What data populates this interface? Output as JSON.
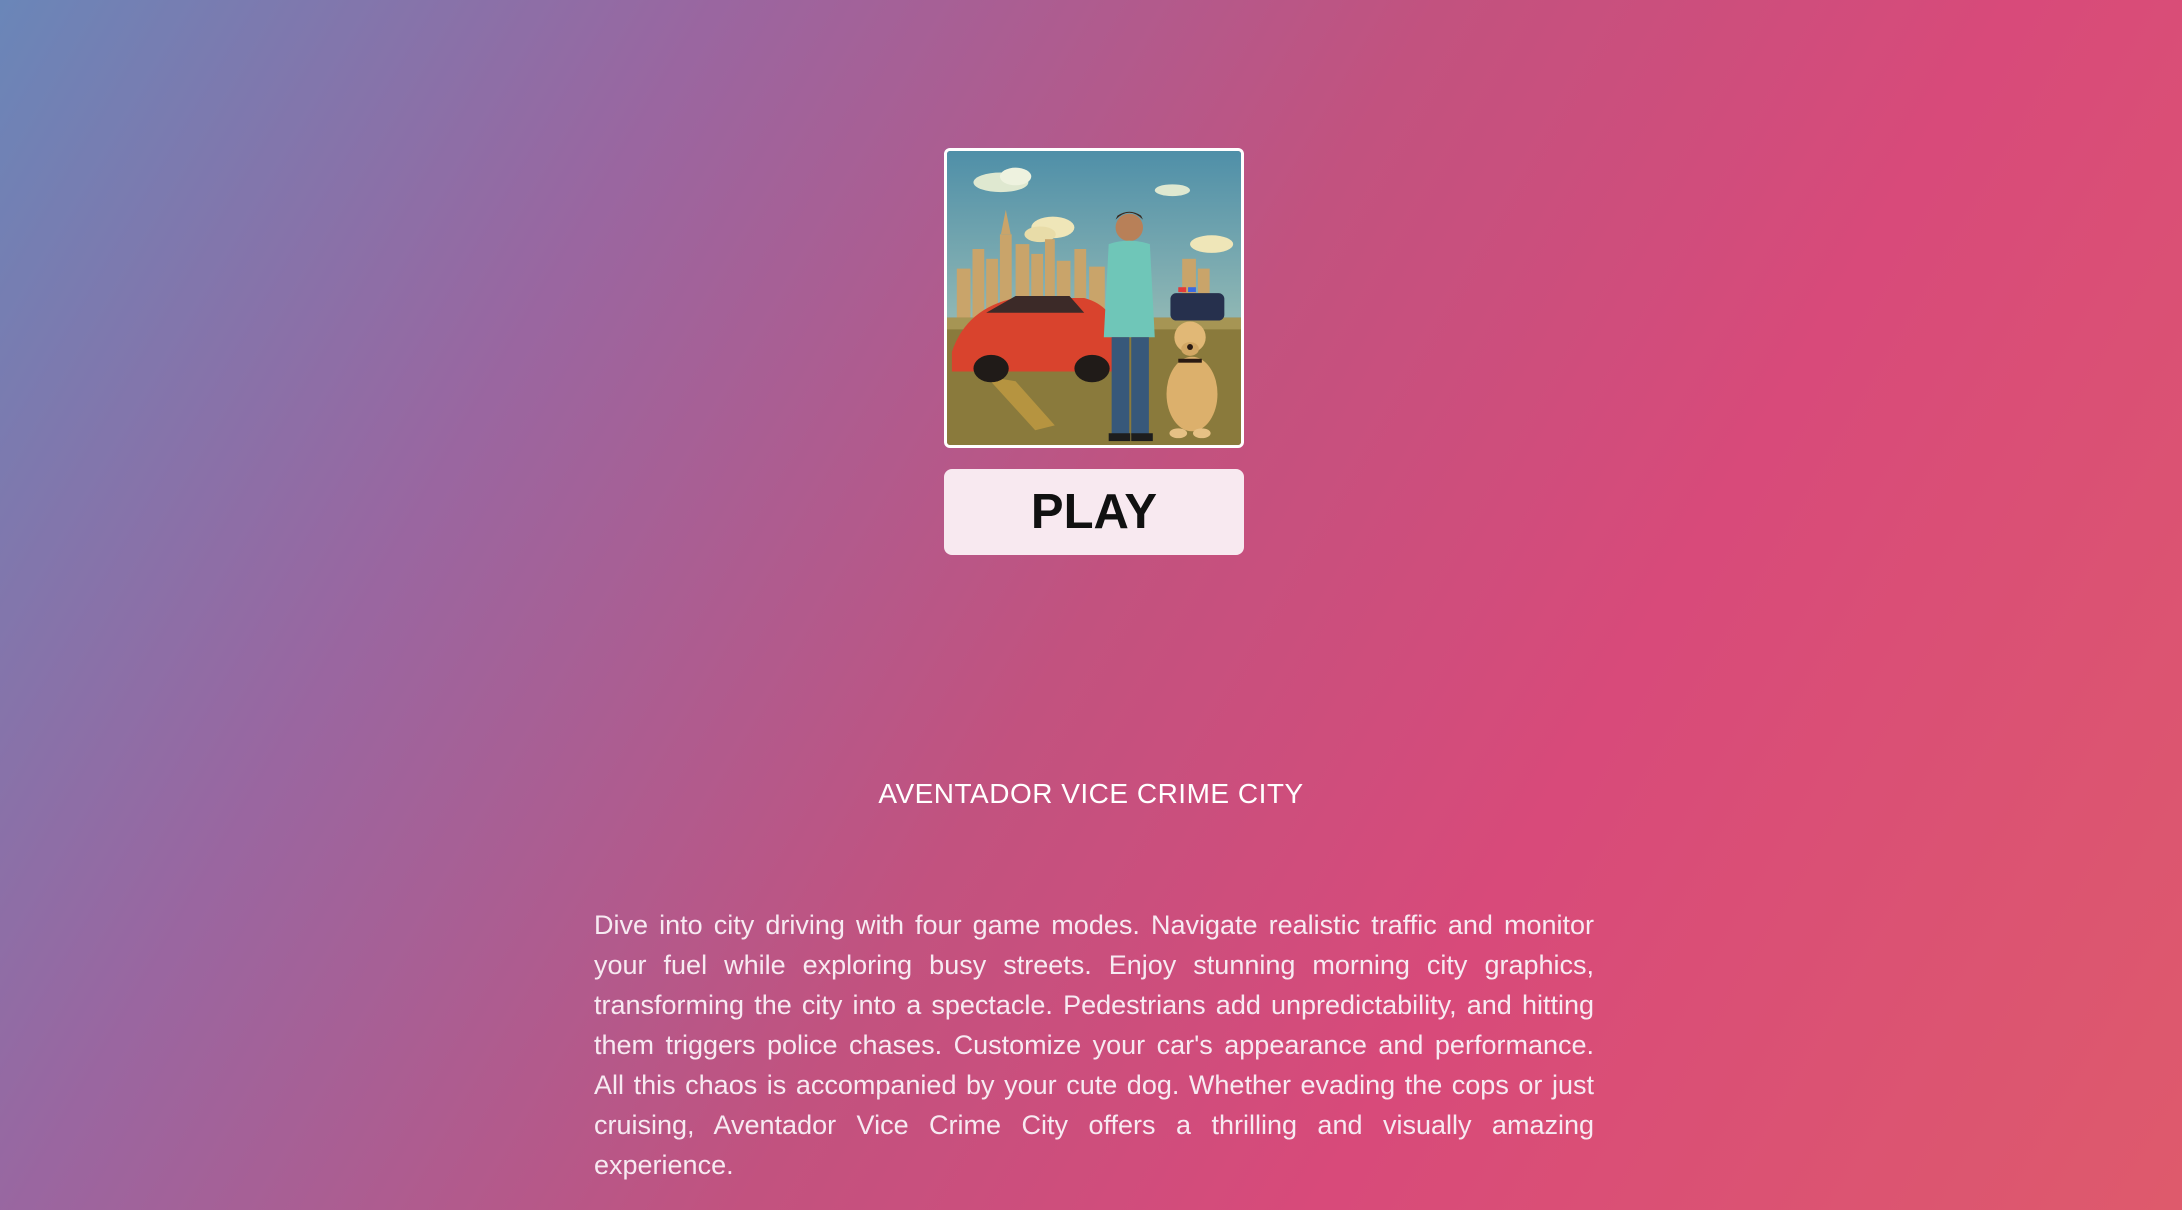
{
  "game": {
    "title": "AVENTADOR VICE CRIME CITY",
    "play_label": "PLAY",
    "description": "Dive into city driving with four game modes. Navigate realistic traffic and monitor your fuel while exploring busy streets. Enjoy stunning morning city graphics, transforming the city into a spectacle. Pedestrians add unpredictability, and hitting them triggers police chases. Customize your car's appearance and performance. All this chaos is accompanied by your cute dog. Whether evading the cops or just cruising, Aventador Vice Crime City offers a thrilling and visually amazing experience.",
    "cover_icon": "game-cover-artwork"
  },
  "colors": {
    "gradient_start": "#6a86b8",
    "gradient_mid": "#d84a7a",
    "gradient_end": "#de5a6c",
    "button_bg": "#f8e9f0",
    "button_text": "#111111"
  }
}
